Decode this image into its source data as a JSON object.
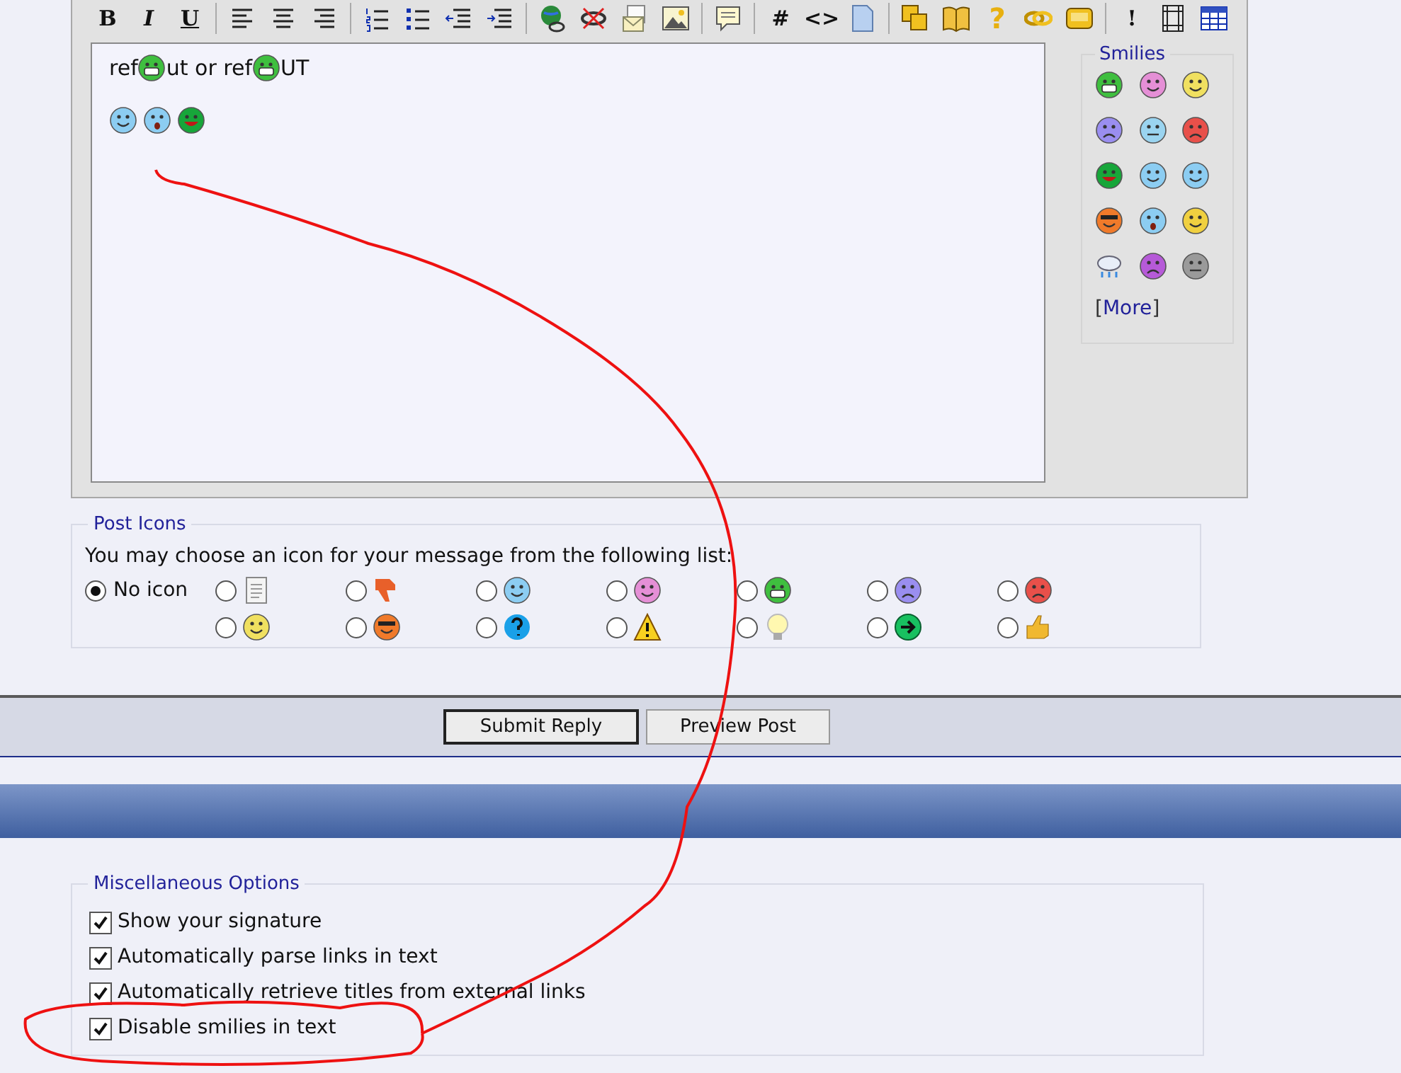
{
  "toolbar": [
    [
      {
        "kind": "bold",
        "text": "B"
      },
      {
        "kind": "italic",
        "text": "I"
      },
      {
        "kind": "underline",
        "text": "U"
      }
    ],
    [
      {
        "kind": "align-left"
      },
      {
        "kind": "align-center"
      },
      {
        "kind": "align-right"
      }
    ],
    [
      {
        "kind": "ordered-list"
      },
      {
        "kind": "bullet-list"
      },
      {
        "kind": "outdent"
      },
      {
        "kind": "indent"
      }
    ],
    [
      {
        "kind": "globe-link"
      },
      {
        "kind": "unlink"
      },
      {
        "kind": "email"
      },
      {
        "kind": "image"
      }
    ],
    [
      {
        "kind": "quote"
      }
    ],
    [
      {
        "kind": "bold",
        "text": "#"
      },
      {
        "kind": "bold",
        "text": "<>"
      },
      {
        "kind": "php"
      }
    ],
    [
      {
        "kind": "squares"
      },
      {
        "kind": "book"
      },
      {
        "kind": "gold",
        "text": "?"
      },
      {
        "kind": "chain"
      },
      {
        "kind": "panel"
      }
    ],
    [
      {
        "kind": "bold",
        "text": "!"
      },
      {
        "kind": "film"
      },
      {
        "kind": "table"
      }
    ]
  ],
  "editor": {
    "lines": [
      [
        {
          "kind": "text",
          "text": "ref"
        },
        {
          "kind": "grin"
        },
        {
          "kind": "text",
          "text": "ut or ref"
        },
        {
          "kind": "grin"
        },
        {
          "kind": "text",
          "text": "UT"
        }
      ],
      [
        {
          "kind": "wink"
        },
        {
          "kind": "shocked"
        },
        {
          "kind": "tongue"
        }
      ]
    ]
  },
  "smilies": {
    "title": "Smilies",
    "items": [
      {
        "kind": "grin"
      },
      {
        "kind": "pink"
      },
      {
        "kind": "smile"
      },
      {
        "kind": "sad"
      },
      {
        "kind": "confused"
      },
      {
        "kind": "angry"
      },
      {
        "kind": "tongue"
      },
      {
        "kind": "wink"
      },
      {
        "kind": "rolleyes"
      },
      {
        "kind": "cool"
      },
      {
        "kind": "shocked"
      },
      {
        "kind": "pair"
      },
      {
        "kind": "rain"
      },
      {
        "kind": "upside"
      },
      {
        "kind": "grey"
      }
    ],
    "more": {
      "open": "[",
      "link": "More",
      "close": "]"
    }
  },
  "post_icons": {
    "title": "Post Icons",
    "prompt": "You may choose an icon for your message from the following list:",
    "rows": [
      [
        {
          "kind": "none",
          "label": "No icon",
          "selected": true
        },
        {
          "kind": "document",
          "selected": false
        },
        {
          "kind": "thumbs-down",
          "selected": false
        },
        {
          "kind": "wink",
          "selected": false
        },
        {
          "kind": "pink",
          "selected": false
        },
        {
          "kind": "grin",
          "selected": false
        },
        {
          "kind": "sad",
          "selected": false
        },
        {
          "kind": "angry",
          "selected": false
        }
      ],
      [
        {
          "kind": "smile",
          "selected": false
        },
        {
          "kind": "cool",
          "selected": false
        },
        {
          "kind": "question",
          "selected": false
        },
        {
          "kind": "warning",
          "selected": false
        },
        {
          "kind": "bulb",
          "selected": false
        },
        {
          "kind": "arrow",
          "selected": false
        },
        {
          "kind": "thumbs-up",
          "selected": false
        }
      ]
    ]
  },
  "buttons": [
    "Submit Reply",
    "Preview Post"
  ],
  "misc_options": {
    "title": "Miscellaneous Options",
    "items": [
      {
        "label": "Show your signature",
        "checked": true
      },
      {
        "label": "Automatically parse links in text",
        "checked": true
      },
      {
        "label": "Automatically retrieve titles from external links",
        "checked": true
      },
      {
        "label": "Disable smilies in text",
        "checked": true
      }
    ]
  }
}
